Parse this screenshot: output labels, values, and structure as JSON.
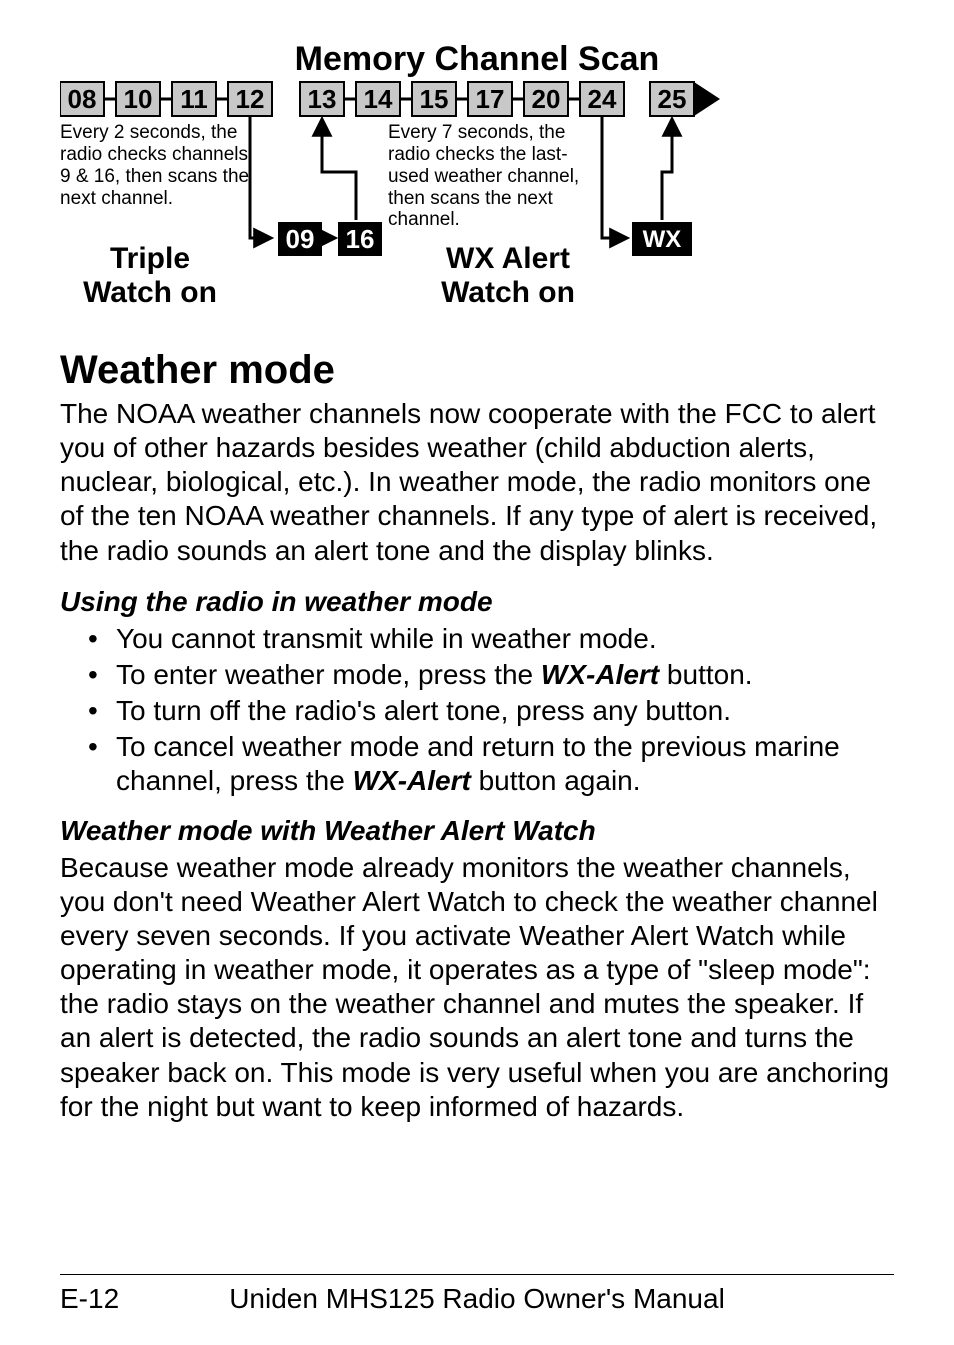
{
  "diagram": {
    "title": "Memory Channel Scan",
    "row_left": [
      "08",
      "10",
      "11",
      "12"
    ],
    "row_right": [
      "13",
      "14",
      "15",
      "17",
      "20",
      "24"
    ],
    "row_cont": "25",
    "sub_left": [
      "09",
      "16"
    ],
    "sub_right": "WX",
    "left_desc": "Every 2 seconds, the radio checks channels 9 & 16, then scans the next channel.",
    "right_desc": "Every 7 seconds, the radio checks the last-used weather channel, then scans the next channel.",
    "left_label_1": "Triple",
    "left_label_2": "Watch on",
    "right_label_1": "WX Alert",
    "right_label_2": "Watch on"
  },
  "section1": {
    "heading": "Weather mode",
    "para": "The NOAA weather channels now cooperate with the FCC to alert you of other hazards besides weather (child abduction alerts, nuclear, biological, etc.). In weather mode, the radio monitors one of the ten NOAA weather channels. If any type of alert is received, the radio sounds an alert tone and the display blinks."
  },
  "section2": {
    "heading": "Using the radio in weather mode",
    "bullets": {
      "b1": "You cannot transmit while in weather mode.",
      "b2_a": "To enter weather mode, press the ",
      "b2_b": "WX-Alert",
      "b2_c": " button.",
      "b3": "To turn off the radio's alert tone, press any button.",
      "b4_a": "To cancel weather mode and return to the previous marine channel, press the ",
      "b4_b": "WX-Alert",
      "b4_c": " button again."
    }
  },
  "section3": {
    "heading": "Weather mode with Weather Alert Watch",
    "para": "Because weather mode already monitors the weather channels, you don't need Weather Alert Watch to check the weather channel every seven seconds. If you activate Weather Alert Watch while operating in weather mode, it operates as a type of \"sleep mode\": the radio stays on the weather channel and mutes the speaker. If an alert is detected, the radio sounds an alert tone and turns the speaker back on. This mode is very useful when you are anchoring for the night but want to keep informed of hazards."
  },
  "footer": {
    "page": "E-12",
    "title": "Uniden MHS125 Radio Owner's Manual"
  }
}
